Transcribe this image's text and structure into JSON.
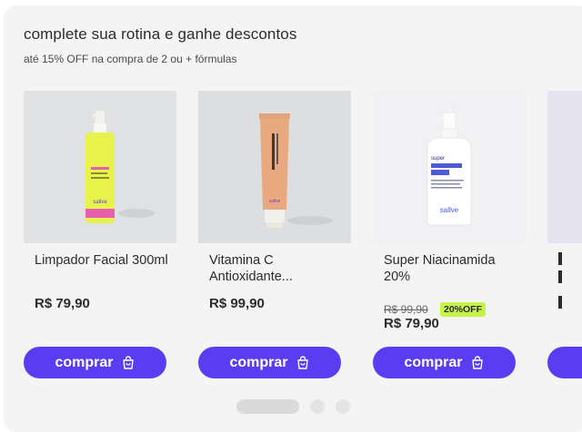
{
  "section": {
    "title": "complete sua rotina e ganhe descontos",
    "subtitle": "até 15% OFF na compra de 2 ou + fórmulas"
  },
  "products": [
    {
      "name": "Limpador Facial 300ml",
      "price": "R$ 79,90",
      "button_label": "comprar",
      "image_bg": "#dfe1e2",
      "brand_label": "sallve"
    },
    {
      "name": "Vitamina C Antioxidante...",
      "price": "R$ 99,90",
      "button_label": "comprar",
      "image_bg": "#dcdedf",
      "brand_label": "sallve"
    },
    {
      "name": "Super Niacinamida 20%",
      "old_price": "R$ 99,90",
      "badge": "20%OFF",
      "price": "R$ 79,90",
      "button_label": "comprar",
      "image_bg": "#f1f1f3",
      "brand_label": "sallve"
    }
  ],
  "carousel": {
    "pages": 3,
    "active_page": 1
  },
  "colors": {
    "accent": "#5a3df0",
    "badge": "#c7f24a",
    "panel_bg": "#f4f4f4"
  }
}
